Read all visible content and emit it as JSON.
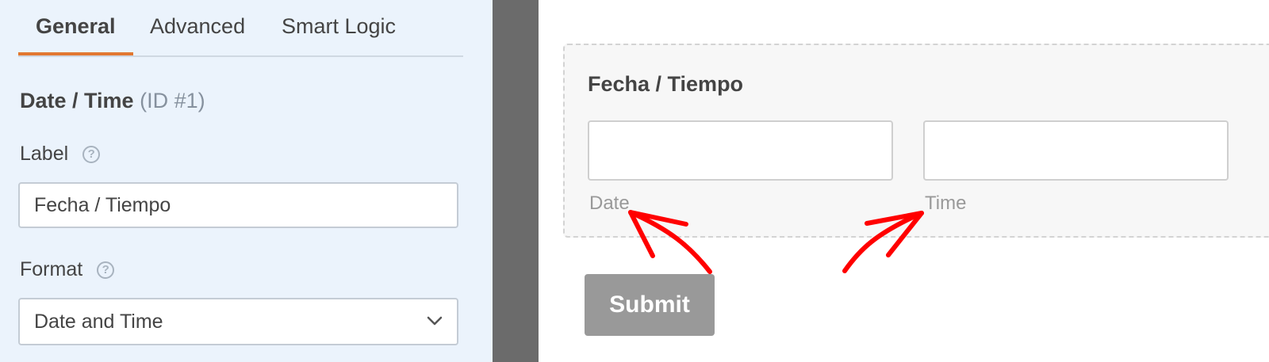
{
  "tabs": [
    {
      "label": "General",
      "active": true
    },
    {
      "label": "Advanced",
      "active": false
    },
    {
      "label": "Smart Logic",
      "active": false
    }
  ],
  "field": {
    "type_name": "Date / Time",
    "id_text": "(ID #1)"
  },
  "options": {
    "label_title": "Label",
    "label_value": "Fecha / Tiempo",
    "format_title": "Format",
    "format_value": "Date and Time"
  },
  "preview": {
    "field_label": "Fecha / Tiempo",
    "date_sublabel": "Date",
    "time_sublabel": "Time",
    "submit_label": "Submit"
  },
  "colors": {
    "accent": "#e27730",
    "panel_bg": "#ebf3fc",
    "arrow": "#ff0000",
    "submit_bg": "#999999"
  },
  "icons": {
    "help": "question-circle-icon",
    "select": "chevron-down-icon"
  }
}
